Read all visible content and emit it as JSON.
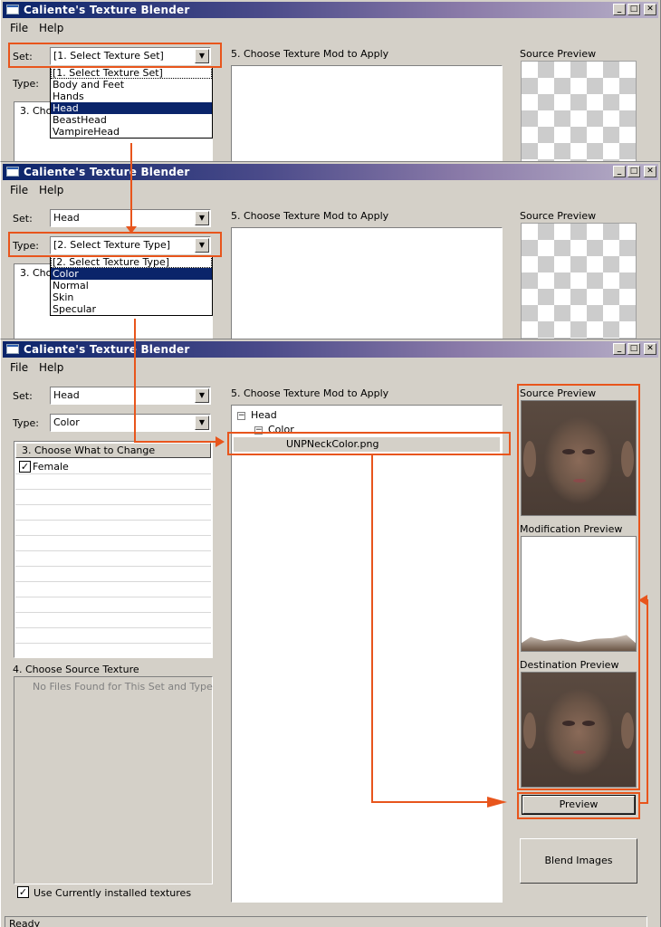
{
  "app_title": "Caliente's Texture Blender",
  "menu": {
    "file": "File",
    "help": "Help"
  },
  "window_buttons": {
    "minimize": "_",
    "maximize": "□",
    "close": "✕"
  },
  "labels": {
    "set": "Set:",
    "type": "Type:",
    "choose_what": "3. Choose What to Change",
    "choose_what_cut": "3. Cho",
    "choose_source": "4. Choose Source Texture",
    "choose_mod": "5. Choose Texture Mod to Apply",
    "source_preview": "Source Preview",
    "modification_preview": "Modification Preview",
    "destination_preview": "Destination Preview",
    "no_files": "No Files Found for This Set and Type",
    "use_installed": "Use Currently installed textures",
    "status": "Ready"
  },
  "frame1": {
    "set_value": "[1. Select Texture Set]",
    "set_options": [
      "[1. Select Texture Set]",
      "Body and Feet",
      "Hands",
      "Head",
      "BeastHead",
      "VampireHead"
    ],
    "set_selected": "Head"
  },
  "frame2": {
    "set_value": "Head",
    "type_value": "[2. Select Texture Type]",
    "type_options": [
      "[2. Select Texture Type]",
      "Color",
      "Normal",
      "Skin",
      "Specular"
    ],
    "type_selected": "Color"
  },
  "frame3": {
    "set_value": "Head",
    "type_value": "Color",
    "what_items": [
      {
        "label": "Female",
        "checked": true
      }
    ],
    "tree": {
      "root": "Head",
      "child": "Color",
      "leaf": "UNPNeckColor.png"
    },
    "use_installed_checked": true,
    "preview_button": "Preview",
    "blend_button": "Blend Images"
  },
  "colors": {
    "accent": "#e8551c",
    "selection": "#0a246a",
    "window_bg": "#d4d0c8"
  }
}
